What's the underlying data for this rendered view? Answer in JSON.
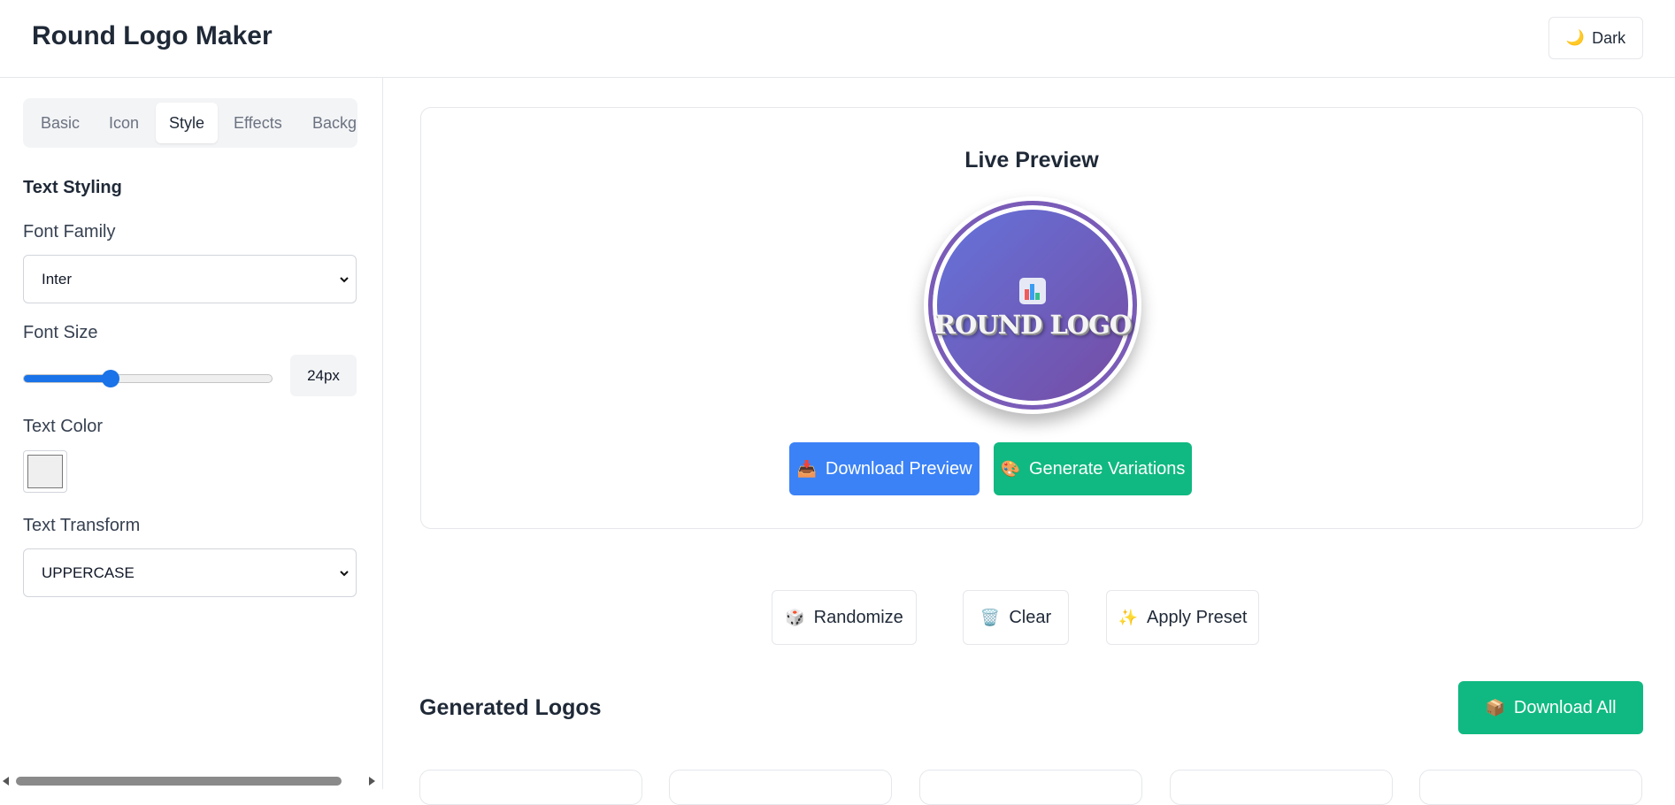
{
  "header": {
    "title": "Round Logo Maker",
    "theme_toggle": {
      "icon": "moon-icon",
      "label": "Dark"
    }
  },
  "sidebar": {
    "tabs": [
      {
        "label": "Basic",
        "active": false
      },
      {
        "label": "Icon",
        "active": false
      },
      {
        "label": "Style",
        "active": true
      },
      {
        "label": "Effects",
        "active": false
      },
      {
        "label": "Backgroun",
        "active": false
      }
    ],
    "section_title": "Text Styling",
    "font_family": {
      "label": "Font Family",
      "value": "Inter"
    },
    "font_size": {
      "label": "Font Size",
      "value": "24px",
      "slider_fraction": 0.35
    },
    "text_color": {
      "label": "Text Color",
      "value": "#efefef"
    },
    "text_transform": {
      "label": "Text Transform",
      "value": "UPPERCASE"
    }
  },
  "preview": {
    "title": "Live Preview",
    "logo": {
      "icon": "bar-chart-icon",
      "text": "ROUND LOGO",
      "gradient": [
        "#6474dc",
        "#764ba2"
      ],
      "border_color": "#7a5cb8"
    },
    "download_button": {
      "icon": "inbox-tray-icon",
      "label": "Download Preview",
      "color": "#3b82f6"
    },
    "variations_button": {
      "icon": "palette-icon",
      "label": "Generate Variations",
      "color": "#10b981"
    }
  },
  "actions": {
    "randomize": {
      "icon": "dice-icon",
      "label": "Randomize"
    },
    "clear": {
      "icon": "wastebasket-icon",
      "label": "Clear"
    },
    "apply_preset": {
      "icon": "sparkles-icon",
      "label": "Apply Preset"
    }
  },
  "generated": {
    "title": "Generated Logos",
    "download_all": {
      "icon": "package-icon",
      "label": "Download All",
      "color": "#10b981"
    }
  }
}
